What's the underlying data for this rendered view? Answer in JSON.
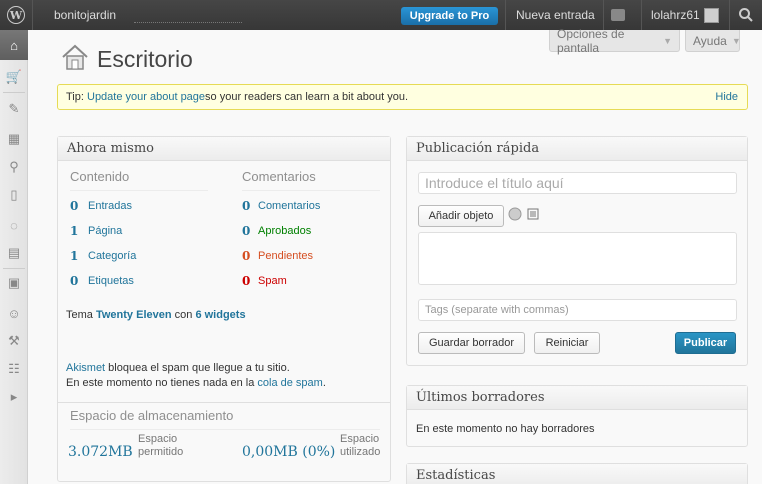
{
  "admin_bar": {
    "site_name": "bonitojardin",
    "upgrade_label": "Upgrade to Pro",
    "new_entry_label": "Nueva entrada",
    "username": "lolahrz61"
  },
  "header": {
    "title": "Escritorio",
    "screen_options_label": "Opciones de pantalla",
    "help_label": "Ayuda"
  },
  "tip": {
    "prefix": "Tip: ",
    "link": "Update your about page",
    "suffix": " so your readers can learn a bit about you.",
    "hide_label": "Hide"
  },
  "right_now": {
    "title": "Ahora mismo",
    "content_heading": "Contenido",
    "comments_heading": "Comentarios",
    "content_rows": [
      {
        "count": "0",
        "label": "Entradas"
      },
      {
        "count": "1",
        "label": "Página"
      },
      {
        "count": "1",
        "label": "Categoría"
      },
      {
        "count": "0",
        "label": "Etiquetas"
      }
    ],
    "comment_rows": [
      {
        "count": "0",
        "label": "Comentarios"
      },
      {
        "count": "0",
        "label": "Aprobados"
      },
      {
        "count": "0",
        "label": "Pendientes"
      },
      {
        "count": "0",
        "label": "Spam"
      }
    ],
    "theme_prefix": "Tema ",
    "theme_name": "Twenty Eleven",
    "theme_middle": " con ",
    "widgets_link": "6 widgets",
    "akismet_link": "Akismet",
    "akismet_text": " bloquea el spam que llegue a tu sitio.",
    "spam_queue_prefix": "En este momento no tienes nada en la ",
    "spam_queue_link": "cola de spam",
    "spam_queue_suffix": ".",
    "storage_heading": "Espacio de almacenamiento",
    "storage_allowed_value": "3.072MB",
    "storage_allowed_label": "Espacio permitido",
    "storage_used_value": "0,00MB (0%)",
    "storage_used_label": "Espacio utilizado"
  },
  "quick_press": {
    "title": "Publicación rápida",
    "title_placeholder": "Introduce el título aquí",
    "add_media_label": "Añadir objeto",
    "tags_placeholder": "Tags (separate with commas)",
    "save_draft_label": "Guardar borrador",
    "reset_label": "Reiniciar",
    "publish_label": "Publicar"
  },
  "recent_drafts": {
    "title": "Últimos borradores",
    "empty_text": "En este momento no hay borradores"
  },
  "stats": {
    "title": "Estadísticas"
  },
  "colors": {
    "link": "#21759b",
    "approved": "#008000",
    "pending": "#d54e21",
    "spam": "#cc0000",
    "publish_button": "#21759b"
  }
}
